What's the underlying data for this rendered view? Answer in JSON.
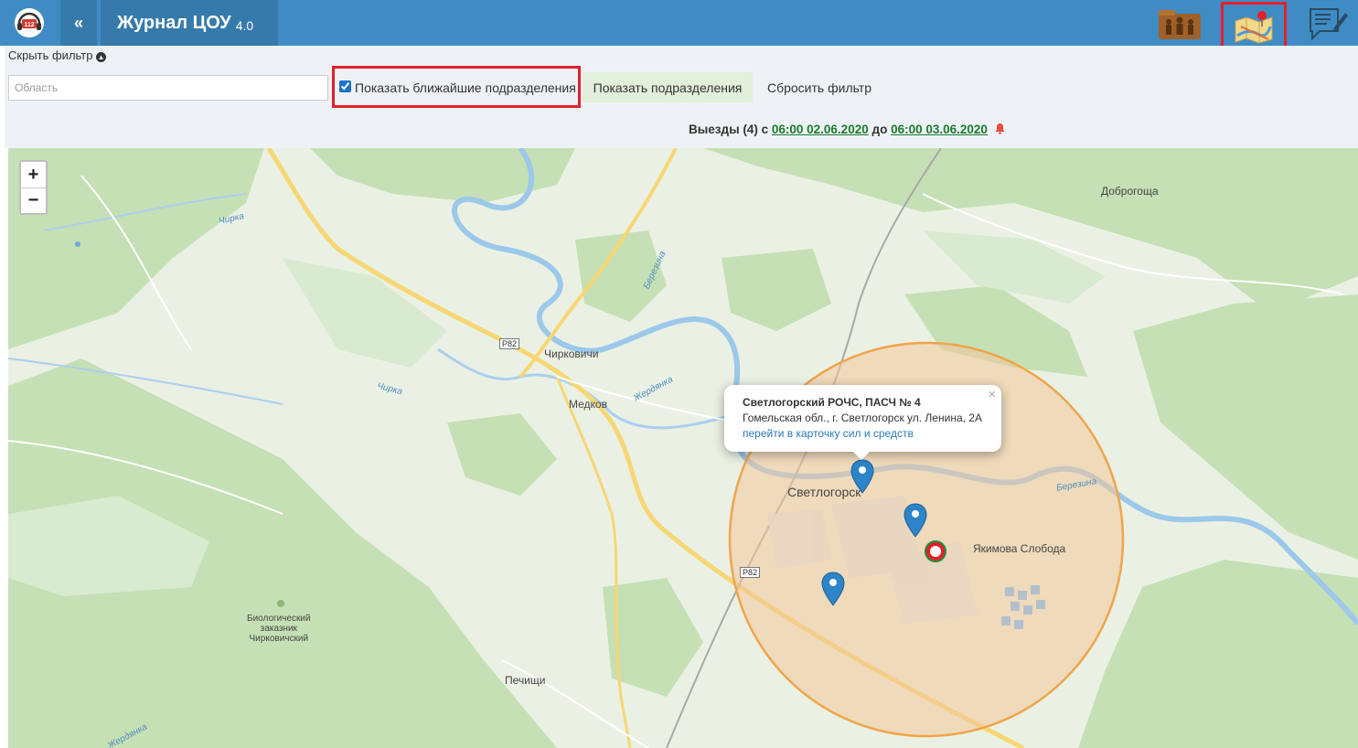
{
  "header": {
    "logo_badge": "112",
    "collapse_label": "«",
    "title": "Журнал ЦОУ",
    "version": "4.0",
    "icons": [
      "units-icon",
      "map-icon",
      "journal-edit-icon"
    ]
  },
  "filter": {
    "hide_label": "Скрыть фильтр",
    "region_placeholder": "Область",
    "region_value": "",
    "nearest_checkbox_label": "Показать ближайшие подразделения",
    "nearest_checked": true,
    "show_units_button": "Показать подразделения",
    "reset_button": "Сбросить фильтр"
  },
  "trips": {
    "prefix": "Выезды (4) с",
    "from": "06:00 02.06.2020",
    "middle": "до",
    "to": "06:00 03.06.2020"
  },
  "map": {
    "zoom_in": "+",
    "zoom_out": "−",
    "places": {
      "dobrogoshcha": "Доброгоща",
      "chirkovichi": "Чирковичи",
      "medkov": "Медков",
      "svetlogorsk": "Светлогорск",
      "yakimova_sloboda": "Якимова Слобода",
      "pechishchi": "Печищи",
      "reserve_1": "Биологический",
      "reserve_2": "заказник",
      "reserve_3": "Чирковичский"
    },
    "rivers": {
      "chirka_1": "Чирка",
      "chirka_2": "Чирка",
      "berezina_1": "Березина",
      "berezina_2": "Березина",
      "zherdyanka_1": "Жердянка",
      "zherdyanka_2": "Жердянка"
    },
    "road_shields": {
      "r82_1": "Р82",
      "r82_2": "Р82"
    },
    "popup": {
      "title": "Светлогорский РОЧС, ПАСЧ № 4",
      "address": "Гомельская обл., г. Светлогорск ул. Ленина, 2А",
      "link": "перейти в карточку сил и средств",
      "close": "×"
    },
    "colors": {
      "header": "#3f8cc4",
      "radius_fill": "#f3c79a",
      "radius_stroke": "#f0a54a",
      "marker": "#2d84c9",
      "highlight": "#e3202b"
    }
  }
}
